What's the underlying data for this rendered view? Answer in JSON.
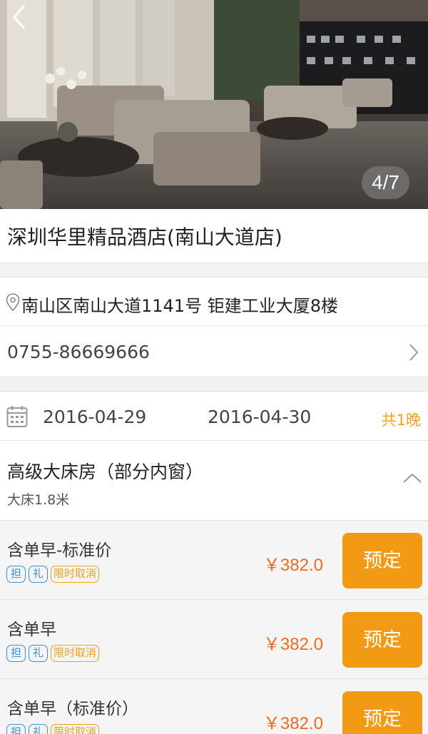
{
  "hero": {
    "page_indicator": "4/7"
  },
  "hotel": {
    "name": "深圳华里精品酒店(南山大道店)",
    "address": "南山区南山大道1141号 钜建工业大厦8楼",
    "phone": "0755-86669666"
  },
  "stay": {
    "checkin": "2016-04-29",
    "checkout": "2016-04-30",
    "nights": "共1晚"
  },
  "room": {
    "name": "高级大床房（部分内窗）",
    "bed": "大床1.8米"
  },
  "tags": {
    "guarantee": "担",
    "gift": "礼",
    "limited_cancel": "限时取消"
  },
  "rates": [
    {
      "title": "含单早-标准价",
      "price": "￥382.0",
      "book_label": "预定"
    },
    {
      "title": "含单早",
      "price": "￥382.0",
      "book_label": "预定"
    },
    {
      "title": "含单早（标准价）",
      "price": "￥382.0",
      "book_label": "预定"
    }
  ],
  "colors": {
    "accent": "#f39a14",
    "price": "#ef6a1c",
    "tag_blue": "#3a8fd8"
  },
  "icons": [
    "back-icon",
    "location-pin-icon",
    "chevron-right-icon",
    "calendar-icon",
    "chevron-up-icon"
  ]
}
